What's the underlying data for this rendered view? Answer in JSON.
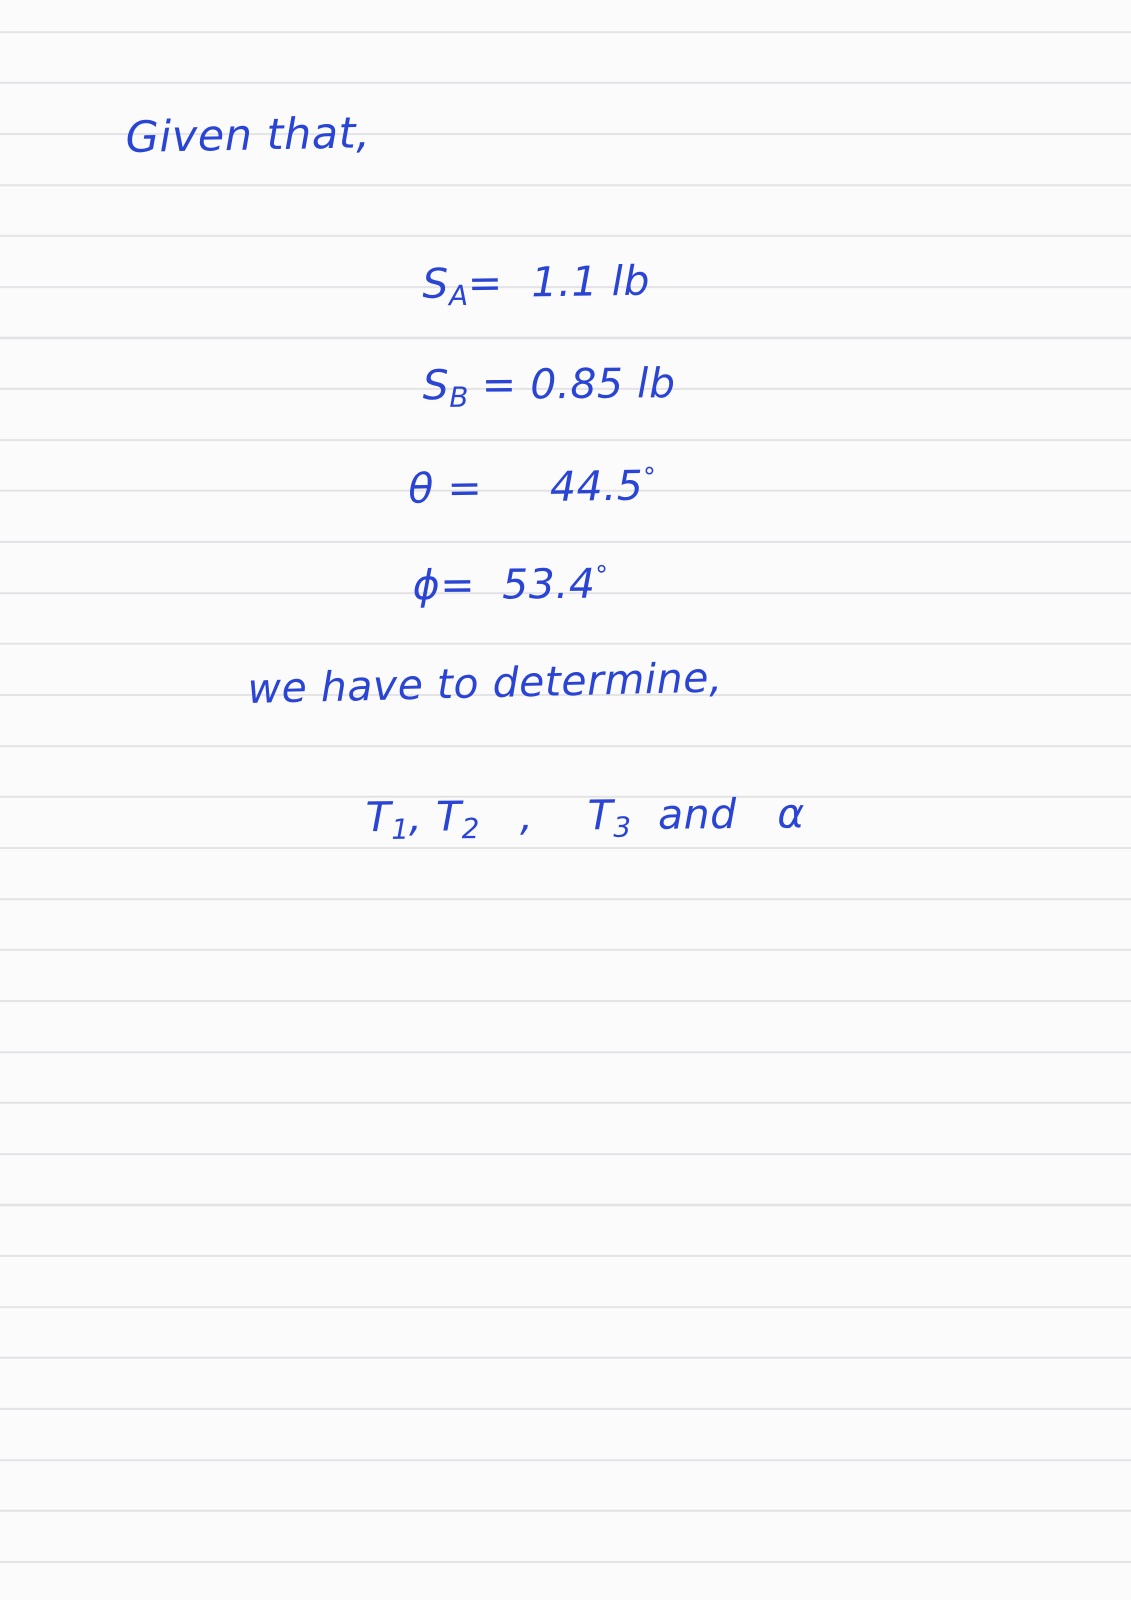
{
  "page": {
    "paper_color": "#fbfbfb",
    "rule_color": "#e3e3e5",
    "ink_color": "#2a44d4",
    "type": "ruled-notebook-paper"
  },
  "notes": {
    "heading": "Given that,",
    "given": [
      {
        "symbol": "S",
        "subscript": "A",
        "equals": "=",
        "value": "1.1",
        "unit": "lb",
        "full_text": "S_A = 1.1 lb"
      },
      {
        "symbol": "S",
        "subscript": "B",
        "equals": "=",
        "value": "0.85",
        "unit": "lb",
        "full_text": "S_B = 0.85 lb"
      },
      {
        "symbol": "θ",
        "subscript": "",
        "equals": "=",
        "value": "44.5",
        "unit": "°",
        "full_text": "θ = 44.5°"
      },
      {
        "symbol": "ϕ",
        "subscript": "",
        "equals": "=",
        "value": "53.4",
        "unit": "°",
        "full_text": "ϕ = 53.4°"
      }
    ],
    "determine_intro": "we have to determine,",
    "unknowns": {
      "first_group": "T",
      "first_sub": "1",
      "comma_1": ",",
      "second": "T",
      "second_sub": "2",
      "comma_2": ",",
      "third": "T",
      "third_sub": "3",
      "conjunction": "and",
      "fourth": "α",
      "full_text": "T1, T2 , T3 and α"
    }
  }
}
